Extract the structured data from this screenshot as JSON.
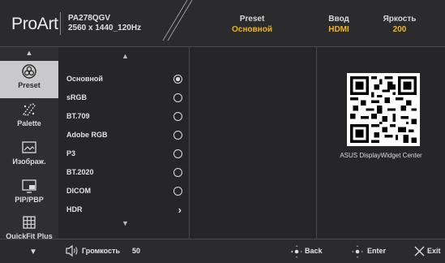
{
  "header": {
    "brand": "ProArt",
    "model": "PA278QGV",
    "resolution": "2560 x 1440_120Hz",
    "preset_label": "Preset",
    "preset_value": "Основной",
    "input_label": "Ввод",
    "input_value": "HDMI",
    "brightness_label": "Яркость",
    "brightness_value": "200"
  },
  "sidebar": {
    "items": [
      {
        "label": "Preset",
        "icon": "preset-icon",
        "active": true
      },
      {
        "label": "Palette",
        "icon": "palette-icon",
        "active": false
      },
      {
        "label": "Изображ.",
        "icon": "image-icon",
        "active": false
      },
      {
        "label": "PIP/PBP",
        "icon": "pip-icon",
        "active": false
      },
      {
        "label": "QuickFit Plus",
        "icon": "grid-icon",
        "active": false
      }
    ]
  },
  "options": [
    {
      "label": "Основной",
      "selected": true
    },
    {
      "label": "sRGB",
      "selected": false
    },
    {
      "label": "BT.709",
      "selected": false
    },
    {
      "label": "Adobe RGB",
      "selected": false
    },
    {
      "label": "P3",
      "selected": false
    },
    {
      "label": "BT.2020",
      "selected": false
    },
    {
      "label": "DICOM",
      "selected": false
    },
    {
      "label": "HDR",
      "submenu": true
    }
  ],
  "qr": {
    "caption": "ASUS DisplayWidget Center"
  },
  "footer": {
    "volume_label": "Громкость",
    "volume_value": "50",
    "back_label": "Back",
    "enter_label": "Enter",
    "exit_label": "Exit"
  },
  "colors": {
    "accent": "#f2b41e",
    "active_bg": "#c9c9cb"
  }
}
